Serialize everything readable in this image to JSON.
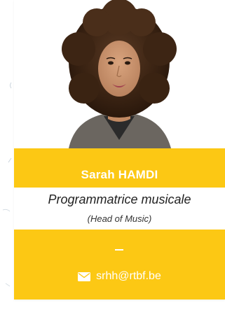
{
  "profile": {
    "name": "Sarah HAMDI",
    "role": "Programmatrice musicale",
    "role_english": "(Head of Music)",
    "separator": "–",
    "email": "srhh@rtbf.be"
  },
  "icons": {
    "email": "envelope-icon"
  },
  "colors": {
    "accent": "#fcc814",
    "text_on_accent": "#ffffff",
    "body_text": "#222222"
  }
}
